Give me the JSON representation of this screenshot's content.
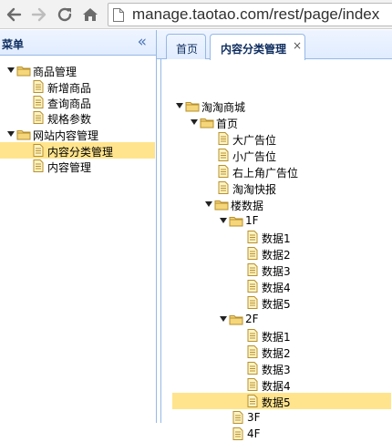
{
  "browser": {
    "url": "manage.taotao.com/rest/page/index",
    "back_icon": "arrow-left-icon",
    "forward_icon": "arrow-right-icon",
    "reload_icon": "reload-icon",
    "home_icon": "home-icon"
  },
  "menu": {
    "title": "菜单",
    "collapse_glyph": "«",
    "items": [
      {
        "label": "商品管理",
        "type": "folder",
        "children": [
          {
            "label": "新增商品"
          },
          {
            "label": "查询商品"
          },
          {
            "label": "规格参数"
          }
        ]
      },
      {
        "label": "网站内容管理",
        "type": "folder",
        "children": [
          {
            "label": "内容分类管理",
            "selected": true
          },
          {
            "label": "内容管理"
          }
        ]
      }
    ]
  },
  "tabs": [
    {
      "label": "首页",
      "active": false
    },
    {
      "label": "内容分类管理",
      "active": true,
      "close": "×"
    }
  ],
  "tree": {
    "root": "淘淘商城",
    "home": "首页",
    "home_items": [
      "大广告位",
      "小广告位",
      "右上角广告位",
      "淘淘快报"
    ],
    "floor_data": "楼数据",
    "floor1": {
      "label": "1F",
      "items": [
        "数据1",
        "数据2",
        "数据3",
        "数据4",
        "数据5"
      ]
    },
    "floor2": {
      "label": "2F",
      "items": [
        "数据1",
        "数据2",
        "数据3",
        "数据4",
        "数据5"
      ]
    },
    "floor3": "3F",
    "floor4": "4F",
    "selected_item": "2F 数据5"
  },
  "colors": {
    "selection": "#ffe48d",
    "panel_border": "#95b8e7",
    "header_text": "#0e2d5f"
  }
}
